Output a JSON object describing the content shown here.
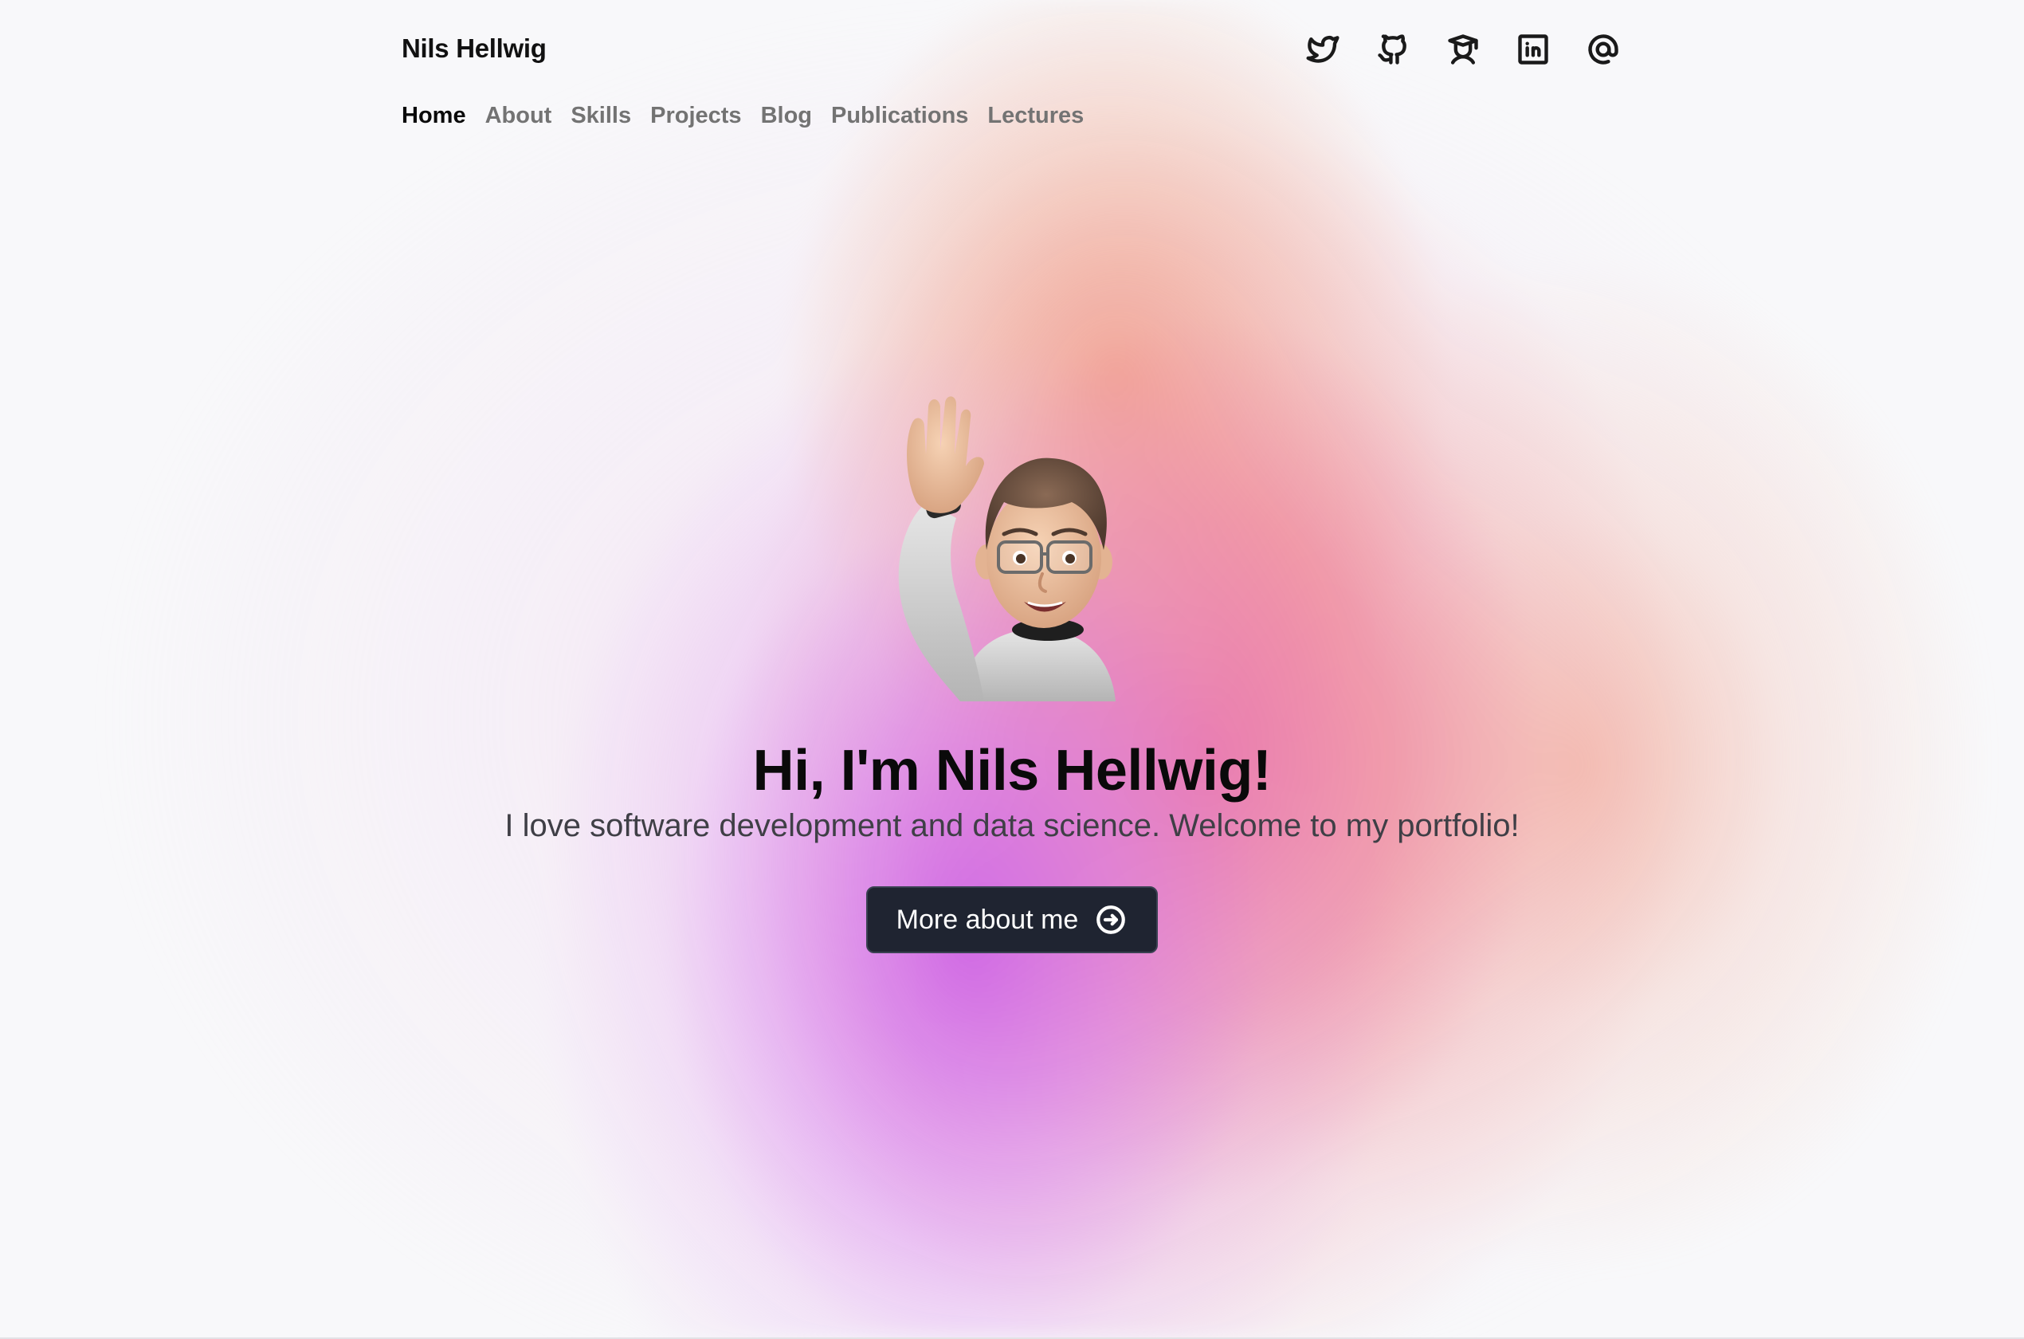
{
  "site": {
    "title": "Nils Hellwig"
  },
  "social": [
    {
      "icon": "twitter-icon"
    },
    {
      "icon": "github-icon"
    },
    {
      "icon": "scholar-cap-icon"
    },
    {
      "icon": "linkedin-icon"
    },
    {
      "icon": "at-email-icon"
    }
  ],
  "nav": {
    "items": [
      {
        "label": "Home",
        "active": true
      },
      {
        "label": "About"
      },
      {
        "label": "Skills"
      },
      {
        "label": "Projects"
      },
      {
        "label": "Blog"
      },
      {
        "label": "Publications"
      },
      {
        "label": "Lectures"
      }
    ]
  },
  "hero": {
    "avatar": "waving-memoji-avatar",
    "title": "Hi, I'm Nils Hellwig!",
    "subtitle": "I love software development and data science. Welcome to my portfolio!",
    "cta_label": "More about me",
    "cta_icon": "arrow-right-circle-icon"
  },
  "colors": {
    "background": "#f8f8fa",
    "button_bg": "#1f2431",
    "nav_inactive": "#737373",
    "gradient_purple": "#cd62e6",
    "gradient_pink": "#ec6e96",
    "gradient_peach": "#f0a087"
  }
}
